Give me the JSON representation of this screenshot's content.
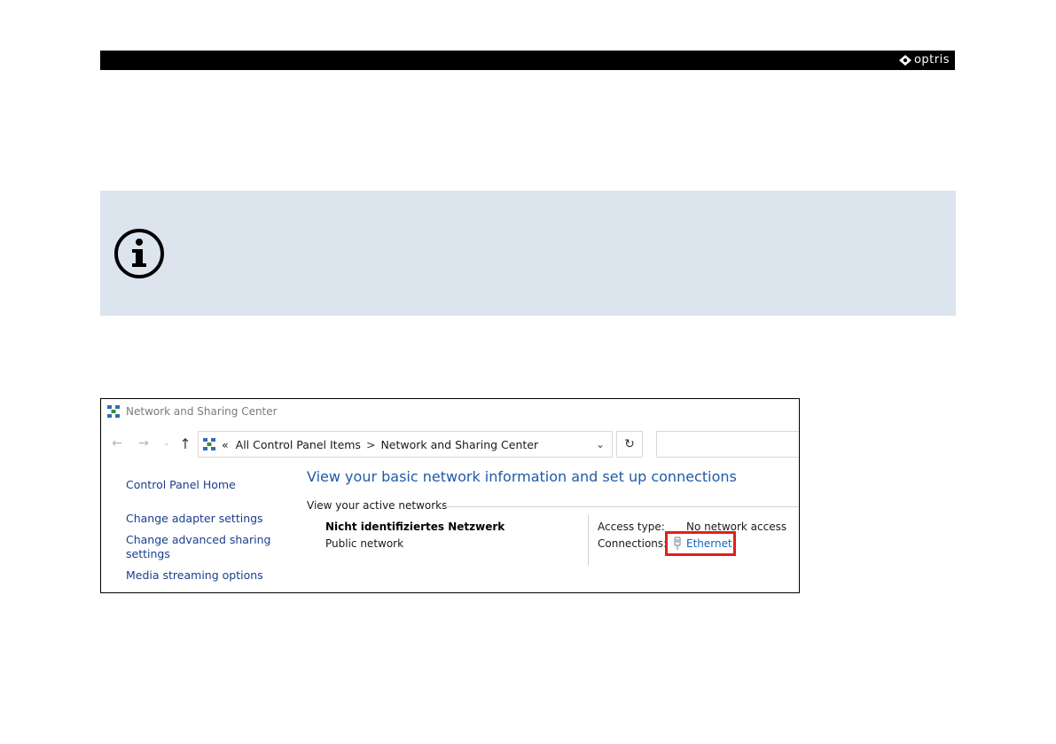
{
  "header": {
    "logo_text": "optris",
    "bar_color": "#000000"
  },
  "info_box": {
    "icon": "info-icon",
    "background": "#dce4ee"
  },
  "window": {
    "title": "Network and Sharing Center",
    "title_icon": "network-center-icon",
    "nav": {
      "back_icon": "back-arrow-icon",
      "forward_icon": "forward-arrow-icon",
      "recent_icon": "recent-dropdown-icon",
      "up_icon": "up-arrow-icon"
    },
    "address": {
      "prefix": "«",
      "crumbs": [
        "All Control Panel Items",
        "Network and Sharing Center"
      ],
      "separator": ">"
    },
    "search_placeholder": "",
    "sidebar": {
      "items": [
        {
          "label": "Control Panel Home"
        },
        {
          "label": "Change adapter settings"
        },
        {
          "label": "Change advanced sharing"
        },
        {
          "label": "settings"
        },
        {
          "label": "Media streaming options"
        }
      ]
    },
    "main": {
      "heading": "View your basic network information and set up connections",
      "active_networks_label": "View your active networks",
      "network_name": "Nicht identifiziertes Netzwerk",
      "network_type": "Public network",
      "access_type_label": "Access type:",
      "access_type_value": "No network access",
      "connections_label": "Connections:",
      "connection_link": "Ethernet",
      "highlight_color": "#e0201b"
    }
  }
}
